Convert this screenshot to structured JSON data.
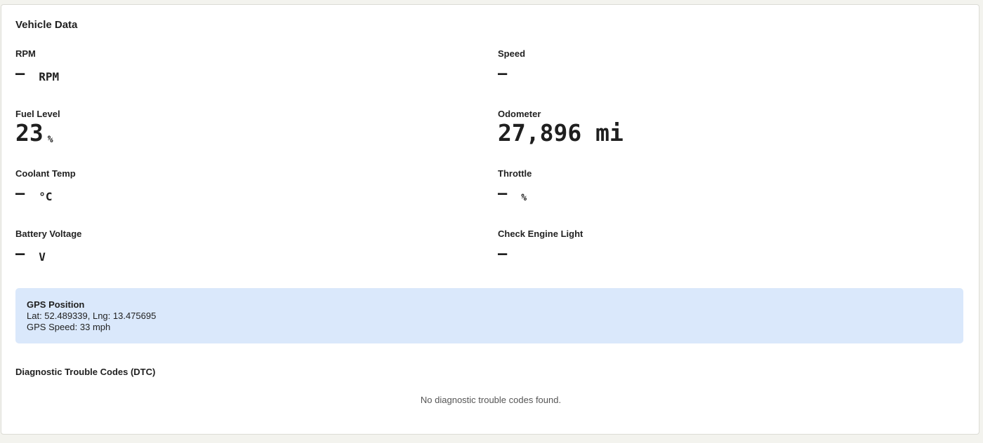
{
  "card": {
    "title": "Vehicle Data"
  },
  "metrics": {
    "rpm": {
      "label": "RPM",
      "value": "—",
      "unit": "RPM"
    },
    "speed": {
      "label": "Speed",
      "value": "—",
      "unit": ""
    },
    "fuel": {
      "label": "Fuel Level",
      "value": "23",
      "unit": "%"
    },
    "odometer": {
      "label": "Odometer",
      "value": "27,896 mi",
      "unit": ""
    },
    "coolant": {
      "label": "Coolant Temp",
      "value": "—",
      "unit": "°C"
    },
    "throttle": {
      "label": "Throttle",
      "value": "—",
      "unit": "%"
    },
    "battery": {
      "label": "Battery Voltage",
      "value": "—",
      "unit": "V"
    },
    "check_engine": {
      "label": "Check Engine Light",
      "value": "—",
      "unit": ""
    }
  },
  "gps": {
    "title": "GPS Position",
    "coords": "Lat: 52.489339, Lng: 13.475695",
    "speed": "GPS Speed: 33 mph"
  },
  "dtc": {
    "title": "Diagnostic Trouble Codes (DTC)",
    "empty_message": "No diagnostic trouble codes found."
  }
}
